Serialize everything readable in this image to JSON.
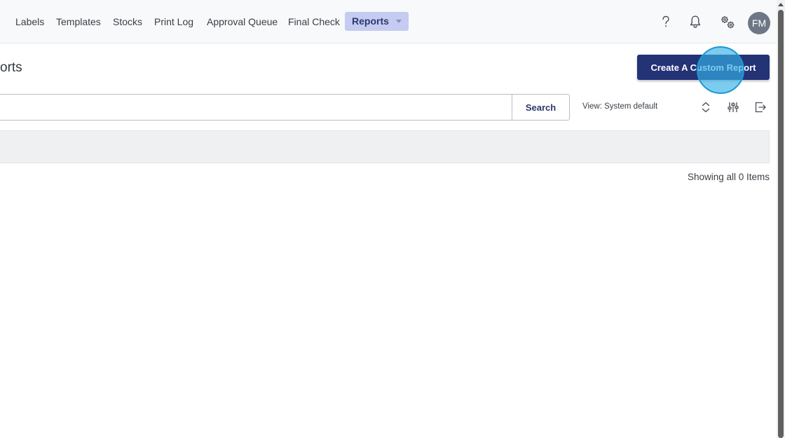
{
  "nav": {
    "items": [
      {
        "label": "Labels"
      },
      {
        "label": "Templates"
      },
      {
        "label": "Stocks"
      },
      {
        "label": "Print Log"
      },
      {
        "label": "Approval Queue"
      },
      {
        "label": "Final Check"
      },
      {
        "label": "Reports"
      }
    ],
    "active": "Reports",
    "icons": [
      "help-icon",
      "bell-icon",
      "settings-gears-icon"
    ],
    "avatar_initials": "FM"
  },
  "page": {
    "title": "orts",
    "create_button_label": "Create A Custom Report"
  },
  "search": {
    "value": "",
    "button_label": "Search"
  },
  "view": {
    "label": "View: System default"
  },
  "toolbar_icons": [
    "sort-icon",
    "filter-sliders-icon",
    "export-icon"
  ],
  "results": {
    "summary": "Showing all 0 Items"
  },
  "colors": {
    "primary": "#243276",
    "active_nav": "#c5cbf1",
    "highlight": "#34b0e6"
  }
}
